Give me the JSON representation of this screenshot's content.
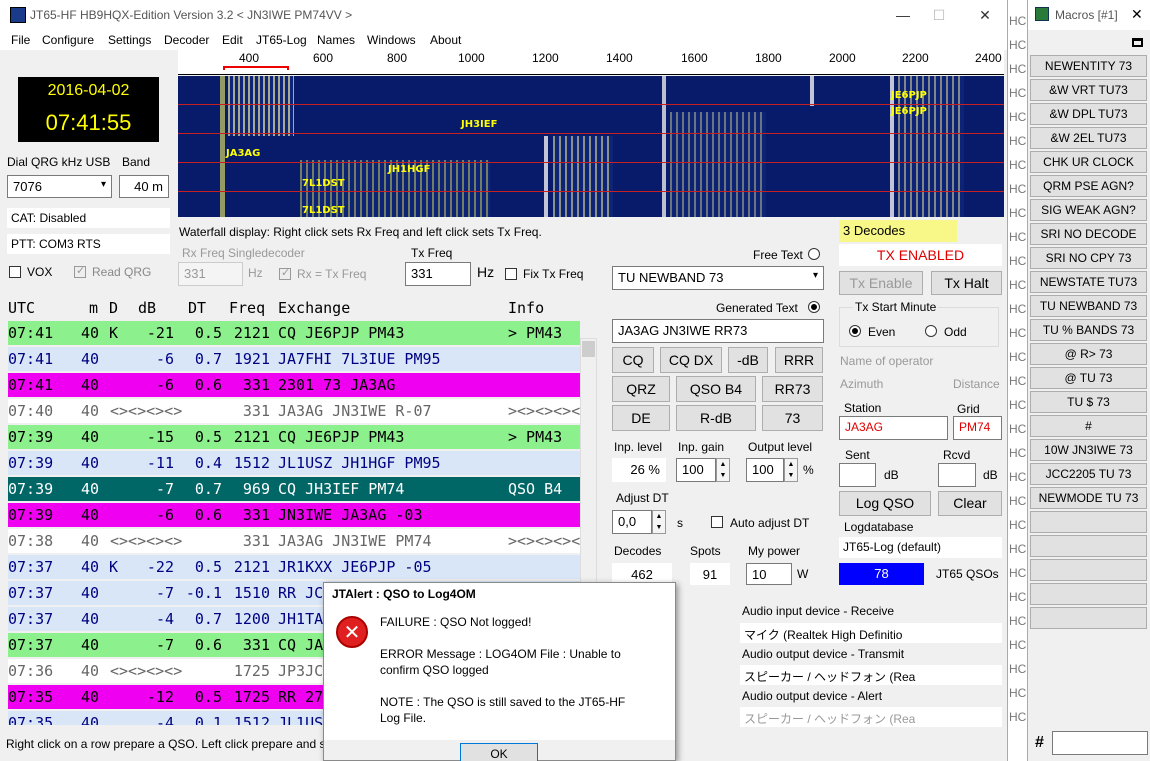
{
  "window": {
    "title": "JT65-HF HB9HQX-Edition Version 3.2   < JN3IWE PM74VV >",
    "minimize": "—",
    "maximize": "☐",
    "close": "✕"
  },
  "menu": [
    "File",
    "Configure",
    "Settings",
    "Decoder",
    "Edit",
    "JT65-Log",
    "Names",
    "Windows",
    "About"
  ],
  "clock": {
    "date": "2016-04-02",
    "time": "07:41:55"
  },
  "dial": {
    "label": "Dial QRG kHz USB",
    "value": "7076",
    "band_label": "Band",
    "band": "40 m"
  },
  "cat": "CAT: Disabled",
  "ptt": "PTT: COM3 RTS",
  "vox": "VOX",
  "read_qrg": "Read QRG",
  "ruler": [
    "400",
    "600",
    "800",
    "1000",
    "1200",
    "1400",
    "1600",
    "1800",
    "2000",
    "2200",
    "2400"
  ],
  "waterfall_labels": [
    "JE6PJP",
    "JE6PJP",
    "JH3IEF",
    "JA3AG",
    "JH1HGF",
    "7L1DST",
    "7L1DST"
  ],
  "wf_hint": "Waterfall display: Right click sets Rx Freq and left click sets Tx Freq.",
  "rx": {
    "label": "Rx Freq Singledecoder",
    "value": "331",
    "unit": "Hz",
    "rxtx": "Rx = Tx Freq"
  },
  "tx": {
    "label": "Tx Freq",
    "value": "331",
    "unit": "Hz",
    "fix": "Fix Tx Freq"
  },
  "decode_header": {
    "utc": "UTC",
    "m": "m",
    "d": "D",
    "db": "dB",
    "dt": "DT",
    "freq": "Freq",
    "exchange": "Exchange",
    "info": "Info"
  },
  "decodes": [
    {
      "utc": "07:41",
      "m": "40",
      "d": "K",
      "db": "-21",
      "dt": "0.5",
      "freq": "2121",
      "ex": "CQ JE6PJP PM43",
      "info": "> PM43",
      "bg": "#8cf08c",
      "fg": "#000"
    },
    {
      "utc": "07:41",
      "m": "40",
      "d": "",
      "db": "-6",
      "dt": "0.7",
      "freq": "1921",
      "ex": "JA7FHI 7L3IUE PM95",
      "info": "",
      "bg": "#d8e6f8",
      "fg": "#000080"
    },
    {
      "utc": "07:41",
      "m": "40",
      "d": "",
      "db": "-6",
      "dt": "0.6",
      "freq": "331",
      "ex": "2301 73 JA3AG",
      "info": "",
      "bg": "#f000f0",
      "fg": "#000"
    },
    {
      "utc": "07:40",
      "m": "40",
      "d": "",
      "db": "<><><><>",
      "dt": "",
      "freq": "331",
      "ex": "JA3AG JN3IWE R-07",
      "info": "><><><><><",
      "bg": "#fff",
      "fg": "#666"
    },
    {
      "utc": "07:39",
      "m": "40",
      "d": "",
      "db": "-15",
      "dt": "0.5",
      "freq": "2121",
      "ex": "CQ JE6PJP PM43",
      "info": "> PM43",
      "bg": "#8cf08c",
      "fg": "#000"
    },
    {
      "utc": "07:39",
      "m": "40",
      "d": "",
      "db": "-11",
      "dt": "0.4",
      "freq": "1512",
      "ex": "JL1USZ JH1HGF PM95",
      "info": "",
      "bg": "#d8e6f8",
      "fg": "#000080"
    },
    {
      "utc": "07:39",
      "m": "40",
      "d": "",
      "db": "-7",
      "dt": "0.7",
      "freq": "969",
      "ex": "CQ JH3IEF PM74",
      "info": "QSO B4",
      "bg": "#006666",
      "fg": "#fff"
    },
    {
      "utc": "07:39",
      "m": "40",
      "d": "",
      "db": "-6",
      "dt": "0.6",
      "freq": "331",
      "ex": "JN3IWE JA3AG -03",
      "info": "",
      "bg": "#f000f0",
      "fg": "#000"
    },
    {
      "utc": "07:38",
      "m": "40",
      "d": "",
      "db": "<><><><>",
      "dt": "",
      "freq": "331",
      "ex": "JA3AG JN3IWE PM74",
      "info": "><><><><><",
      "bg": "#fff",
      "fg": "#666"
    },
    {
      "utc": "07:37",
      "m": "40",
      "d": "K",
      "db": "-22",
      "dt": "0.5",
      "freq": "2121",
      "ex": "JR1KXX JE6PJP -05",
      "info": "",
      "bg": "#d8e6f8",
      "fg": "#000080"
    },
    {
      "utc": "07:37",
      "m": "40",
      "d": "",
      "db": "-7",
      "dt": "-0.1",
      "freq": "1510",
      "ex": "RR JC",
      "info": "",
      "bg": "#d8e6f8",
      "fg": "#000080"
    },
    {
      "utc": "07:37",
      "m": "40",
      "d": "",
      "db": "-4",
      "dt": "0.7",
      "freq": "1200",
      "ex": "JH1TA",
      "info": "",
      "bg": "#d8e6f8",
      "fg": "#000080"
    },
    {
      "utc": "07:37",
      "m": "40",
      "d": "",
      "db": "-7",
      "dt": "0.6",
      "freq": "331",
      "ex": "CQ JA",
      "info": "",
      "bg": "#8cf08c",
      "fg": "#000"
    },
    {
      "utc": "07:36",
      "m": "40",
      "d": "",
      "db": "<><><><>",
      "dt": "",
      "freq": "1725",
      "ex": "JP3JC",
      "info": "",
      "bg": "#fff",
      "fg": "#666"
    },
    {
      "utc": "07:35",
      "m": "40",
      "d": "",
      "db": "-12",
      "dt": "0.5",
      "freq": "1725",
      "ex": "RR 27",
      "info": "",
      "bg": "#f000f0",
      "fg": "#000"
    },
    {
      "utc": "07:35",
      "m": "40",
      "d": "",
      "db": "-4",
      "dt": "0.1",
      "freq": "1512",
      "ex": "JL1US",
      "info": "",
      "bg": "#d8e6f8",
      "fg": "#000080"
    }
  ],
  "status": "Right click on a row prepare a QSO. Left click prepare and sta",
  "free_text": {
    "label": "Free Text",
    "value": "TU NEWBAND 73"
  },
  "gen_text": {
    "label": "Generated Text",
    "value": "JA3AG JN3IWE RR73"
  },
  "msgbtns": [
    "CQ",
    "CQ DX",
    "-dB",
    "RRR",
    "QRZ",
    "QSO B4",
    "RR73",
    "DE",
    "R-dB",
    "73"
  ],
  "levels": {
    "inp_label": "Inp. level",
    "inp": "26 %",
    "gain_label": "Inp. gain",
    "gain": "100",
    "out_label": "Output level",
    "out": "100",
    "pct": "%"
  },
  "adjust": {
    "label": "Adjust DT",
    "value": "0,0",
    "unit": "s",
    "auto": "Auto adjust DT"
  },
  "stats": {
    "dec_label": "Decodes",
    "dec": "462",
    "spots_label": "Spots",
    "spots": "91",
    "pow_label": "My power",
    "pow": "10",
    "pow_unit": "W"
  },
  "right": {
    "decodes": "3 Decodes",
    "tx_enabled": "TX ENABLED",
    "tx_enable": "Tx Enable",
    "tx_halt": "Tx Halt",
    "start_min": "Tx Start Minute",
    "even": "Even",
    "odd": "Odd",
    "name_op": "Name of operator",
    "azimuth": "Azimuth",
    "distance": "Distance",
    "station_label": "Station",
    "station": "JA3AG",
    "grid_label": "Grid",
    "grid": "PM74",
    "sent": "Sent",
    "rcvd": "Rcvd",
    "db": "dB",
    "log_qso": "Log QSO",
    "clear": "Clear",
    "logdb": "Logdatabase",
    "logdb_val": "JT65-Log (default)",
    "qsos": "78",
    "qsos_label": "JT65 QSOs"
  },
  "audio": {
    "in_label": "Audio input device - Receive",
    "in": "マイク (Realtek High Definitio",
    "out_label": "Audio output device - Transmit",
    "out": "スピーカー / ヘッドフォン (Rea",
    "alert_label": "Audio output device - Alert",
    "alert": "スピーカー / ヘッドフォン (Rea"
  },
  "dialog": {
    "title": "JTAlert : QSO to Log4OM",
    "line1": "FAILURE : QSO Not logged!",
    "line2": "ERROR Message : LOG4OM File : Unable to",
    "line3": "confirm QSO logged",
    "line4": "NOTE : The QSO is still saved to the JT65-HF",
    "line5": "Log File.",
    "ok": "OK",
    "icon": "error-icon"
  },
  "macros": {
    "title": "Macros [#1]",
    "close": "✕",
    "items": [
      "NEWENTITY 73",
      "&W VRT TU73",
      "&W DPL TU73",
      "&W 2EL TU73",
      "CHK UR CLOCK",
      "QRM PSE AGN?",
      "SIG WEAK AGN?",
      "SRI NO DECODE",
      "SRI NO CPY 73",
      "NEWSTATE TU73",
      "TU NEWBAND 73",
      "TU % BANDS 73",
      "@ R> 73",
      "@ TU 73",
      "TU $ 73",
      "#",
      "10W JN3IWE 73",
      "JCC2205 TU 73",
      "NEWMODE TU 73",
      "",
      "",
      "",
      "",
      ""
    ],
    "hash": "#"
  },
  "edge_text": "HC",
  "colors": {
    "waterfall": "#081a6a",
    "tx_enabled": "#e00000",
    "qsos_bg": "#0000ff"
  }
}
